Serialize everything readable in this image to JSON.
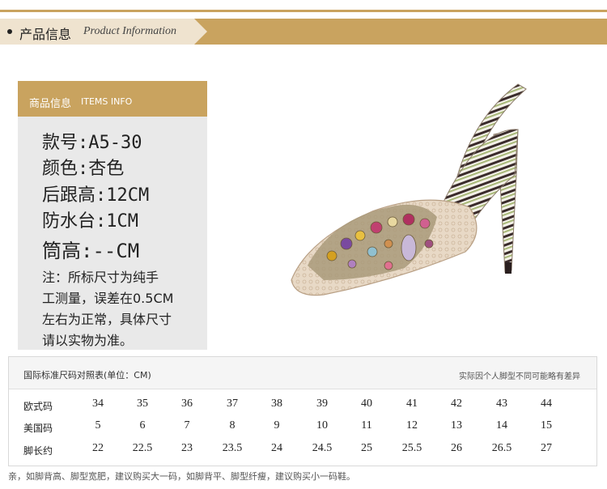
{
  "header": {
    "title_cn": "产品信息",
    "title_en": "Product Information"
  },
  "info": {
    "head_cn": "商品信息",
    "head_en": "ITEMS INFO",
    "specs": [
      "款号:A5-30",
      "颜色:杏色",
      "后跟高:12CM",
      "防水台:1CM",
      "筒高:--CM"
    ],
    "note_lines": [
      "注：所标尺寸为纯手",
      "工测量，误差在0.5CM",
      "左右为正常，具体尺寸",
      "请以实物为准。"
    ]
  },
  "size_table": {
    "title": "国际标准尺码对照表(单位：CM)",
    "note": "实际因个人脚型不同可能略有差异",
    "rows": [
      {
        "label": "欧式码",
        "values": [
          "34",
          "35",
          "36",
          "37",
          "38",
          "39",
          "40",
          "41",
          "42",
          "43",
          "44"
        ]
      },
      {
        "label": "美国码",
        "values": [
          "5",
          "6",
          "7",
          "8",
          "9",
          "10",
          "11",
          "12",
          "13",
          "14",
          "15"
        ]
      },
      {
        "label": "脚长约",
        "values": [
          "22",
          "22.5",
          "23",
          "23.5",
          "24",
          "24.5",
          "25",
          "25.5",
          "26",
          "26.5",
          "27"
        ]
      }
    ]
  },
  "footer": "亲，如脚背高、脚型宽肥，建议购买大一码，如脚背平、脚型纤瘦，建议购买小一码鞋。",
  "colors": {
    "accent": "#c9a35f",
    "panel": "#e9e9e9"
  }
}
